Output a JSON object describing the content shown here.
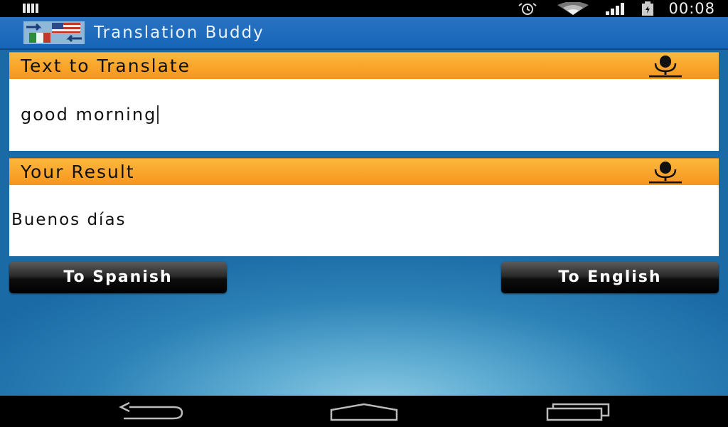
{
  "status_bar": {
    "time": "00:08"
  },
  "app_bar": {
    "title": "Translation Buddy"
  },
  "source_panel": {
    "header_label": "Text to Translate",
    "input_value": "good morning"
  },
  "result_panel": {
    "header_label": "Your Result",
    "result_text": "Buenos días"
  },
  "actions": {
    "to_spanish_label": "To Spanish",
    "to_english_label": "To English"
  },
  "icons": {
    "mic": "microphone-icon",
    "back": "back-icon",
    "home": "home-icon",
    "recents": "recents-icon"
  },
  "colors": {
    "app_bar": "#1565b8",
    "panel_header": "#f7941d",
    "background": "#1f75ad",
    "button": "#000000"
  }
}
